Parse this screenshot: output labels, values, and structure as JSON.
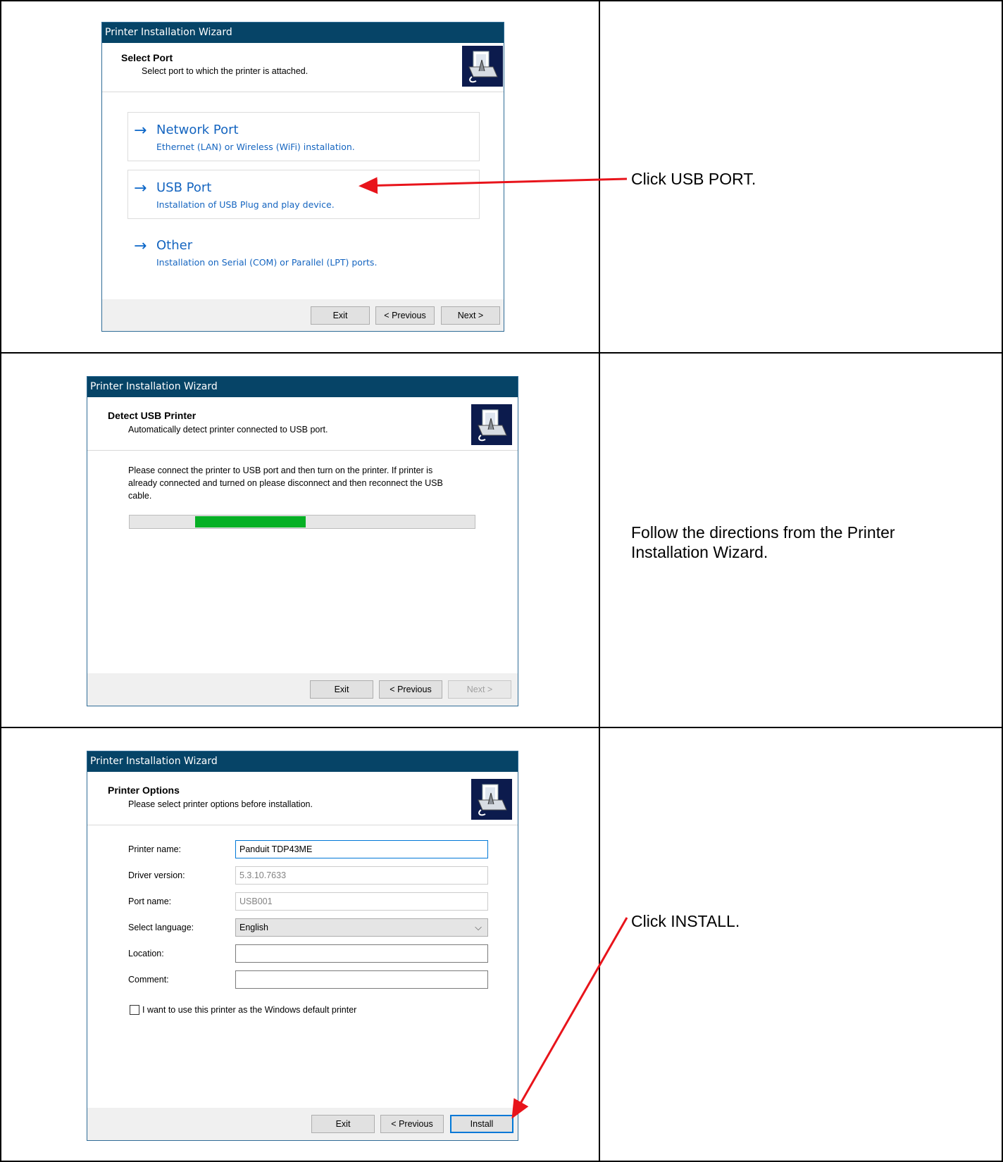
{
  "steps": [
    {
      "wizard": {
        "title": "Printer Installation Wizard",
        "heading": "Select Port",
        "subheading": "Select port to which the printer is attached.",
        "ports": [
          {
            "title": "Network Port",
            "description": "Ethernet (LAN) or Wireless (WiFi) installation."
          },
          {
            "title": "USB Port",
            "description": "Installation of USB Plug and play device."
          },
          {
            "title": "Other",
            "description": "Installation on Serial (COM) or Parallel (LPT) ports."
          }
        ],
        "buttons": {
          "exit": "Exit",
          "previous": "< Previous",
          "next": "Next >"
        }
      },
      "annotation": "Click USB PORT."
    },
    {
      "wizard": {
        "title": "Printer Installation Wizard",
        "heading": "Detect USB Printer",
        "subheading": "Automatically detect printer connected to USB port.",
        "message_lines": [
          "Please connect the printer to USB port and then turn on the printer. If printer is",
          "already connected and turned on please disconnect and then reconnect the USB",
          "cable."
        ],
        "progress": {
          "start_fraction": 0.19,
          "end_fraction": 0.51,
          "color": "#06b025"
        },
        "buttons": {
          "exit": "Exit",
          "previous": "< Previous",
          "next": "Next >"
        }
      },
      "annotation_lines": [
        "Follow the directions from the Printer",
        "Installation Wizard."
      ]
    },
    {
      "wizard": {
        "title": "Printer Installation Wizard",
        "heading": "Printer Options",
        "subheading": "Please select printer options before installation.",
        "fields": {
          "printer_name": {
            "label": "Printer name:",
            "value": "Panduit TDP43ME"
          },
          "driver_version": {
            "label": "Driver version:",
            "value": "5.3.10.7633"
          },
          "port_name": {
            "label": "Port name:",
            "value": "USB001"
          },
          "language": {
            "label": "Select language:",
            "value": "English"
          },
          "location": {
            "label": "Location:",
            "value": ""
          },
          "comment": {
            "label": "Comment:",
            "value": ""
          }
        },
        "default_printer_checkbox": {
          "label": "I want to use this printer as the Windows default printer",
          "checked": false
        },
        "buttons": {
          "exit": "Exit",
          "previous": "< Previous",
          "install": "Install"
        }
      },
      "annotation": "Click INSTALL."
    }
  ],
  "colors": {
    "titlebar": "#064467",
    "link": "#1565c0",
    "annotation_arrow": "#e8141b",
    "progress": "#06b025"
  }
}
